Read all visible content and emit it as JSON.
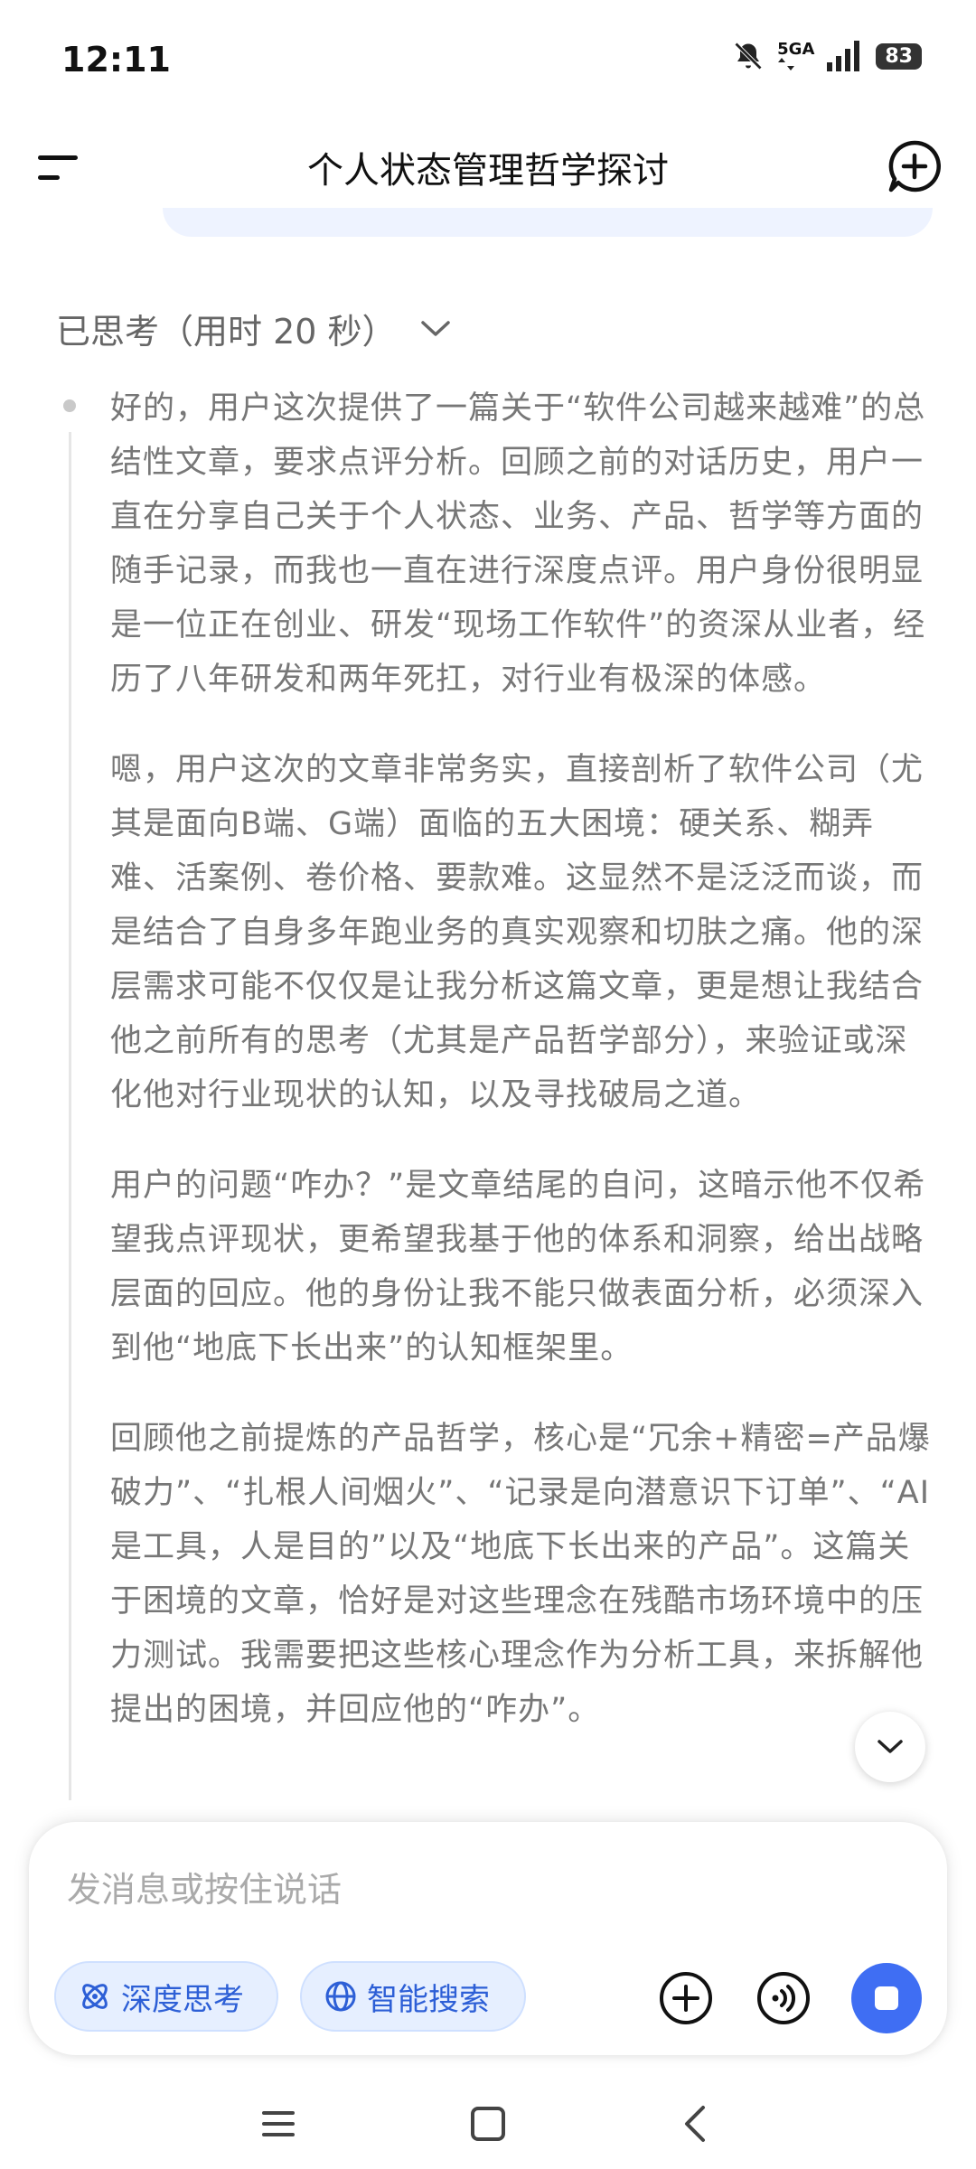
{
  "status_bar": {
    "time": "12:11",
    "network": "5GA",
    "battery": "83"
  },
  "header": {
    "title": "个人状态管理哲学探讨"
  },
  "thinking": {
    "label": "已思考（用时 20 秒）",
    "paragraphs": [
      "好的，用户这次提供了一篇关于“软件公司越来越难”的总结性文章，要求点评分析。回顾之前的对话历史，用户一直在分享自己关于个人状态、业务、产品、哲学等方面的随手记录，而我也一直在进行深度点评。用户身份很明显是一位正在创业、研发“现场工作软件”的资深从业者，经历了八年研发和两年死扛，对行业有极深的体感。",
      "嗯，用户这次的文章非常务实，直接剖析了软件公司（尤其是面向B端、G端）面临的五大困境：硬关系、糊弄难、活案例、卷价格、要款难。这显然不是泛泛而谈，而是结合了自身多年跑业务的真实观察和切肤之痛。他的深层需求可能不仅仅是让我分析这篇文章，更是想让我结合他之前所有的思考（尤其是产品哲学部分），来验证或深化他对行业现状的认知，以及寻找破局之道。",
      "用户的问题“咋办？”是文章结尾的自问，这暗示他不仅希望我点评现状，更希望我基于他的体系和洞察，给出战略层面的回应。他的身份让我不能只做表面分析，必须深入到他“地底下长出来”的认知框架里。",
      "回顾他之前提炼的产品哲学，核心是“冗余+精密=产品爆破力”、“扎根人间烟火”、“记录是向潜意识下订单”、“AI是工具，人是目的”以及“地底下长出来的产品”。这篇关于困境的文章，恰好是对这些理念在残酷市场环境中的压力测试。我需要把这些核心理念作为分析工具，来拆解他提出的困境，并回应他的“咋办”。"
    ]
  },
  "composer": {
    "placeholder": "发消息或按住说话",
    "deep_think": "深度思考",
    "smart_search": "智能搜索"
  },
  "colors": {
    "accent": "#3f6ef3",
    "chip_bg": "#e6efff",
    "chip_text": "#2d5fd6"
  }
}
